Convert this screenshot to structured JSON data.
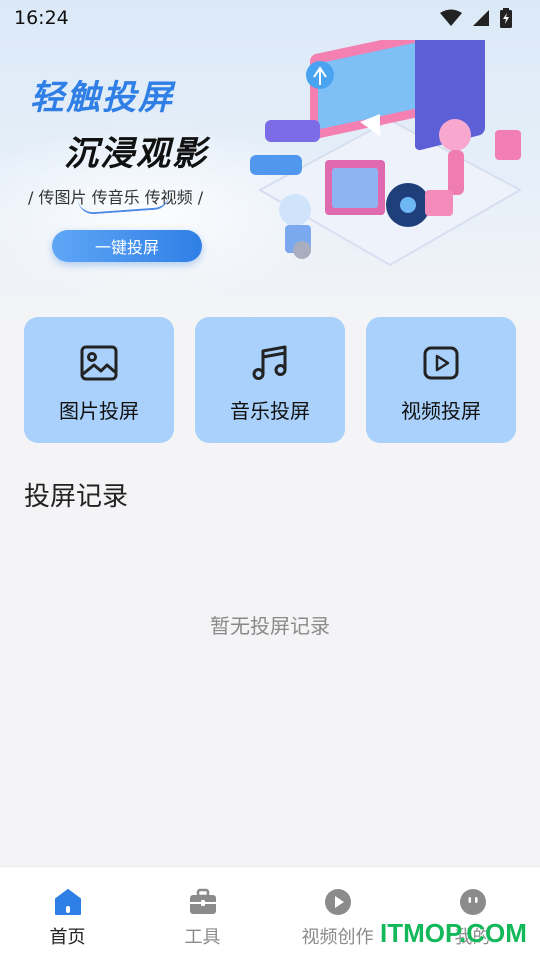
{
  "status_bar": {
    "time": "16:24"
  },
  "banner": {
    "headline_1": "轻触投屏",
    "headline_2": "沉浸观影",
    "tagline": "/ 传图片 传音乐 传视频 /",
    "cta_label": "一键投屏"
  },
  "features": [
    {
      "label": "图片投屏",
      "icon": "image-icon"
    },
    {
      "label": "音乐投屏",
      "icon": "music-note-icon"
    },
    {
      "label": "视频投屏",
      "icon": "video-play-icon"
    }
  ],
  "records": {
    "title": "投屏记录",
    "empty_text": "暂无投屏记录"
  },
  "tabbar": {
    "items": [
      {
        "label": "首页",
        "icon": "home-icon",
        "active": true
      },
      {
        "label": "工具",
        "icon": "toolbox-icon",
        "active": false
      },
      {
        "label": "视频创作",
        "icon": "play-circle-icon",
        "active": false
      },
      {
        "label": "我的",
        "icon": "profile-face-icon",
        "active": false
      }
    ]
  },
  "watermark": "ITMOP.COM",
  "colors": {
    "accent": "#2f7fe6",
    "card_bg": "#a9d1fb",
    "watermark": "#12b85a"
  }
}
